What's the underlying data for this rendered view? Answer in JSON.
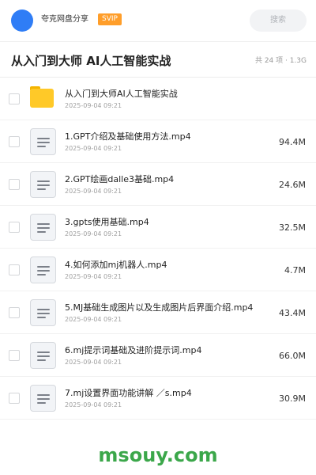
{
  "header": {
    "app_name": "夸克网盘分享",
    "badge": "SVIP",
    "search_placeholder": "搜索"
  },
  "folder": {
    "title": "从入门到大师 AI人工智能实战",
    "meta": "共 24 项 · 1.3G"
  },
  "files": [
    {
      "name": "从入门到大师AI人工智能实战",
      "date": "2025-09-04 09:21",
      "size": "",
      "icon": "folder-icon"
    },
    {
      "name": "1.GPT介绍及基础使用方法.mp4",
      "date": "2025-09-04 09:21",
      "size": "94.4M",
      "icon": "video-file-icon"
    },
    {
      "name": "2.GPT绘画dalle3基础.mp4",
      "date": "2025-09-04 09:21",
      "size": "24.6M",
      "icon": "video-file-icon"
    },
    {
      "name": "3.gpts使用基础.mp4",
      "date": "2025-09-04 09:21",
      "size": "32.5M",
      "icon": "video-file-icon"
    },
    {
      "name": "4.如何添加mj机器人.mp4",
      "date": "2025-09-04 09:21",
      "size": "4.7M",
      "icon": "video-file-icon"
    },
    {
      "name": "5.MJ基础生成图片以及生成图片后界面介绍.mp4",
      "date": "2025-09-04 09:21",
      "size": "43.4M",
      "icon": "video-file-icon"
    },
    {
      "name": "6.mj提示词基础及进阶提示词.mp4",
      "date": "2025-09-04 09:21",
      "size": "66.0M",
      "icon": "video-file-icon"
    },
    {
      "name": "7.mj设置界面功能讲解 ／s.mp4",
      "date": "2025-09-04 09:21",
      "size": "30.9M",
      "icon": "video-file-icon"
    }
  ],
  "watermark": "msouy.com",
  "colors": {
    "accent_blue": "#2f7df6",
    "svip_orange": "#ff9e2a",
    "folder_yellow": "#ffc928",
    "watermark_green": "#3ba74a"
  }
}
